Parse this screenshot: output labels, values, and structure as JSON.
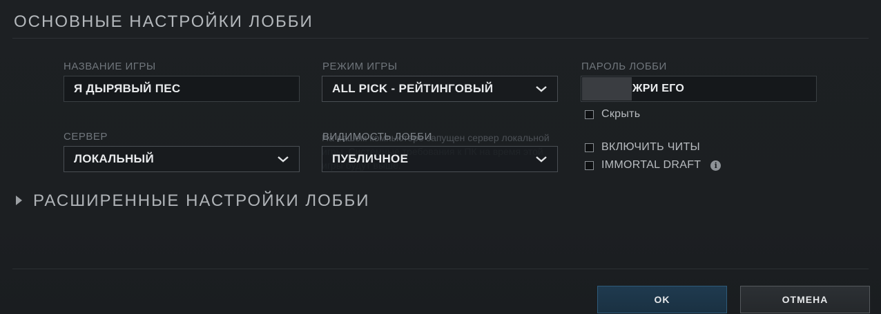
{
  "header": {
    "title": "ОСНОВНЫЕ НАСТРОЙКИ ЛОББИ"
  },
  "game_name": {
    "label": "НАЗВАНИЕ ИГРЫ",
    "value": "Я ДЫРЯВЫЙ ПЕС"
  },
  "game_mode": {
    "label": "РЕЖИМ ИГРЫ",
    "value": "ALL PICK - РЕЙТИНГОВЫЙ"
  },
  "lobby_password": {
    "label": "ПАРОЛЬ ЛОББИ",
    "value": "ЖРИ ЕГО",
    "hide_label": "Скрыть",
    "hide_checked": false
  },
  "server": {
    "label": "СЕРВЕР",
    "value": "ЛОКАЛЬНЫЙ"
  },
  "visibility": {
    "label": "ВИДИМОСТЬ ЛОББИ",
    "value": "ПУБЛИЧНОЕ"
  },
  "options": {
    "cheats_label": "ВКЛЮЧИТЬ ЧИТЫ",
    "cheats_checked": false,
    "immortal_draft_label": "IMMORTAL DRAFT",
    "immortal_draft_checked": false
  },
  "tooltip": {
    "text": "На вашем компьютере запущен сервер локальной игры. Системные требования к ПК на время этой игры будут выше."
  },
  "advanced": {
    "title": "РАСШИРЕННЫЕ НАСТРОЙКИ ЛОББИ"
  },
  "footer": {
    "ok_label": "OK",
    "cancel_label": "ОТМЕНА"
  },
  "colors": {
    "background": "#1e2124",
    "ok_button": "#1f3a4f",
    "cancel_button": "#2c3034",
    "field_bg": "#15181b"
  }
}
